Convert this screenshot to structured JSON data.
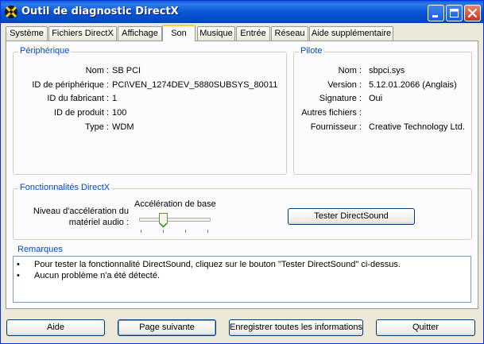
{
  "window": {
    "title": "Outil de diagnostic DirectX"
  },
  "tabs": [
    "Système",
    "Fichiers DirectX",
    "Affichage",
    "Son",
    "Musique",
    "Entrée",
    "Réseau",
    "Aide supplémentaire"
  ],
  "active_tab": "Son",
  "device": {
    "title": "Périphérique",
    "rows": [
      {
        "label": "Nom :",
        "value": "SB PCI"
      },
      {
        "label": "ID de périphérique :",
        "value": "PCI\\VEN_1274DEV_5880SUBSYS_80011"
      },
      {
        "label": "ID du fabricant :",
        "value": "1"
      },
      {
        "label": "ID de produit :",
        "value": "100"
      },
      {
        "label": "Type :",
        "value": "WDM"
      }
    ]
  },
  "driver": {
    "title": "Pilote",
    "rows": [
      {
        "label": "Nom :",
        "value": "sbpci.sys"
      },
      {
        "label": "Version :",
        "value": "5.12.01.2066 (Anglais)"
      },
      {
        "label": "Signature :",
        "value": "Oui"
      },
      {
        "label": "Autres fichiers :",
        "value": ""
      },
      {
        "label": "Fournisseur :",
        "value": "Creative Technology Ltd."
      }
    ]
  },
  "features": {
    "title": "Fonctionnalités DirectX",
    "accel_label_line1": "Niveau d'accélération du",
    "accel_label_line2": "matériel audio :",
    "slider_value_label": "Accélération de base",
    "slider_level": 1,
    "slider_levels": 4,
    "test_button": "Tester DirectSound"
  },
  "notes": {
    "title": "Remarques",
    "bullet": "•",
    "items": [
      "Pour tester la fonctionnalité DirectSound, cliquez sur le bouton \"Tester DirectSound\" ci-dessus.",
      "Aucun problème n'a été détecté."
    ]
  },
  "buttons": {
    "help": "Aide",
    "next_page": "Page suivante",
    "save_all": "Enregistrer toutes les informations",
    "quit": "Quitter"
  },
  "colors": {
    "title_bar": "#0a5fd8",
    "group_title": "#0046d5",
    "window_bg": "#ece9d8"
  }
}
